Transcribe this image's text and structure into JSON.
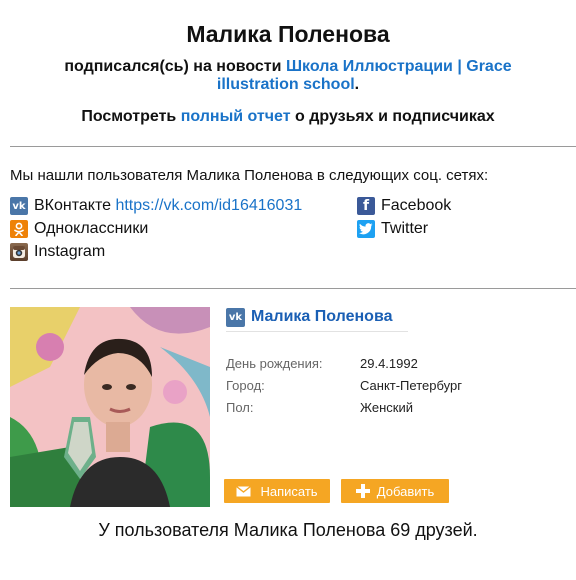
{
  "header": {
    "name": "Малика Поленова",
    "subscribed_text": "подписался(сь) на новости",
    "group_link": "Школа Иллюстрации | Grace illustration school",
    "period": ".",
    "report_prefix": "Посмотреть",
    "report_link": "полный отчет",
    "report_suffix": "о друзьях и подписчиках"
  },
  "found_text": "Мы нашли пользователя Малика Поленова в следующих соц. сетях:",
  "networks": {
    "vk": {
      "label": "ВКонтакте",
      "url": "https://vk.com/id16416031",
      "color": "#4a76a8"
    },
    "facebook": {
      "label": "Facebook",
      "color": "#3b5998"
    },
    "ok": {
      "label": "Одноклассники",
      "color": "#ee8208"
    },
    "twitter": {
      "label": "Twitter",
      "color": "#1da1f2"
    },
    "instagram": {
      "label": "Instagram"
    }
  },
  "profile": {
    "name": "Малика Поленова",
    "birthday_label": "День рождения:",
    "birthday": "29.4.1992",
    "city_label": "Город:",
    "city": "Санкт-Петербург",
    "gender_label": "Пол:",
    "gender": "Женский",
    "write_button": "Написать",
    "add_button": "Добавить"
  },
  "friends_text": "У пользователя Малика Поленова 69 друзей.",
  "colors": {
    "link": "#1a73c8",
    "button": "#f5a623"
  }
}
